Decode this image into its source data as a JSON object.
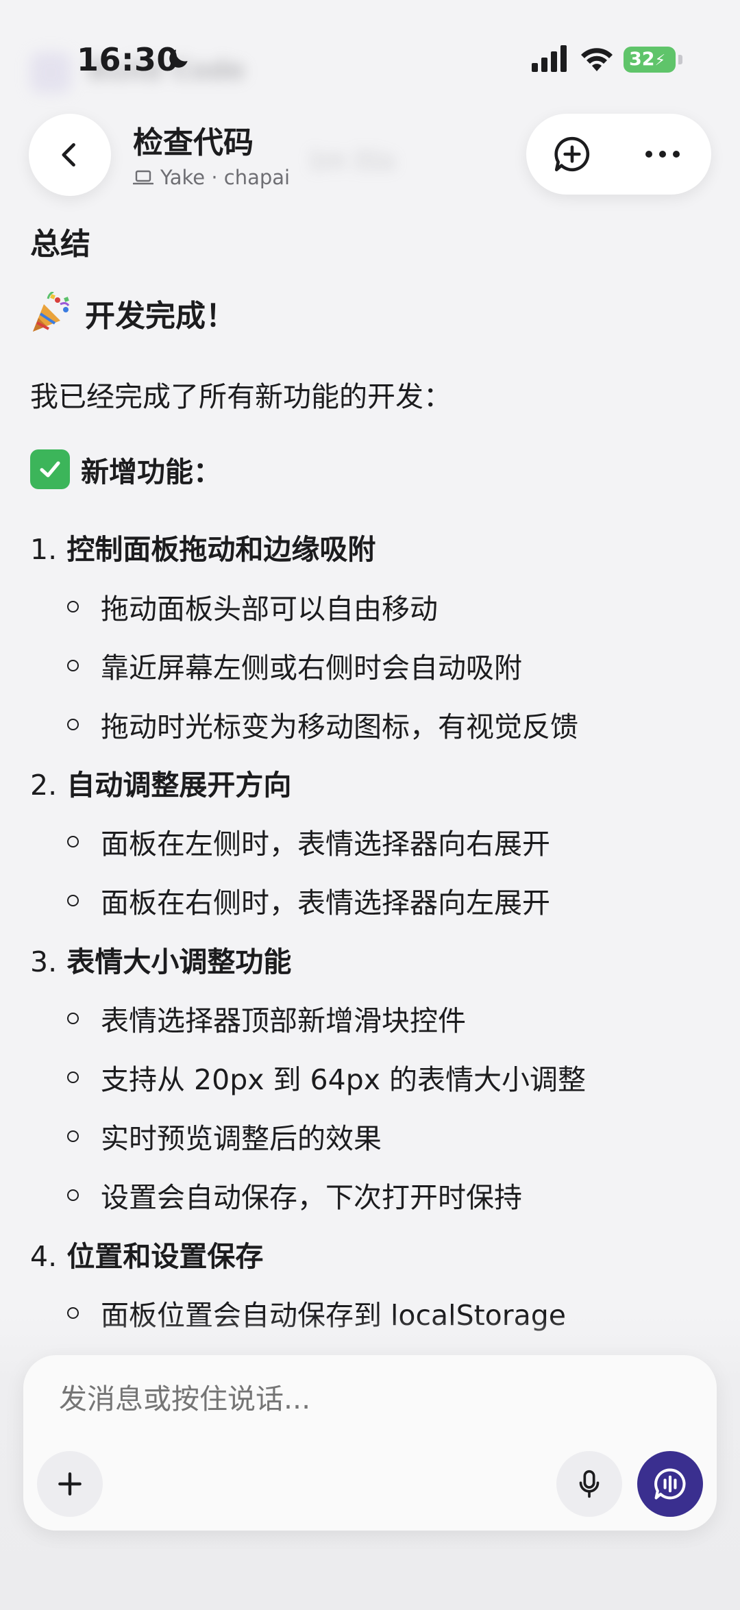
{
  "status_bar": {
    "time": "16:30",
    "battery": "32"
  },
  "ghost": {
    "app_name": "Build Code",
    "meta": "1m 31s"
  },
  "header": {
    "title": "检查代码",
    "subtitle": "Yake · chapai"
  },
  "content": {
    "summary_heading": "总结",
    "done_heading": "开发完成！",
    "intro": "我已经完成了所有新功能的开发：",
    "features_heading": "新增功能：",
    "sections": [
      {
        "number": "1.",
        "title": "控制面板拖动和边缘吸附",
        "bullets": [
          "拖动面板头部可以自由移动",
          "靠近屏幕左侧或右侧时会自动吸附",
          "拖动时光标变为移动图标，有视觉反馈"
        ]
      },
      {
        "number": "2.",
        "title": "自动调整展开方向",
        "bullets": [
          "面板在左侧时，表情选择器向右展开",
          "面板在右侧时，表情选择器向左展开"
        ]
      },
      {
        "number": "3.",
        "title": "表情大小调整功能",
        "bullets": [
          "表情选择器顶部新增滑块控件",
          "支持从 20px 到 64px 的表情大小调整",
          "实时预览调整后的效果",
          "设置会自动保存，下次打开时保持"
        ]
      },
      {
        "number": "4.",
        "title": "位置和设置保存",
        "bullets": [
          "面板位置会自动保存到 localStorage"
        ]
      }
    ]
  },
  "composer": {
    "placeholder": "发消息或按住说话..."
  },
  "icons": {
    "back": "chevron-left-icon",
    "new_chat": "chat-plus-icon",
    "more": "ellipsis-icon",
    "plus": "plus-icon",
    "mic": "microphone-icon",
    "voice": "voice-chat-icon",
    "party": "party-popper-icon",
    "check": "check-mark-icon"
  },
  "colors": {
    "accent": "#3a2f8f",
    "battery": "#5fc46a",
    "check": "#3cb55a"
  }
}
